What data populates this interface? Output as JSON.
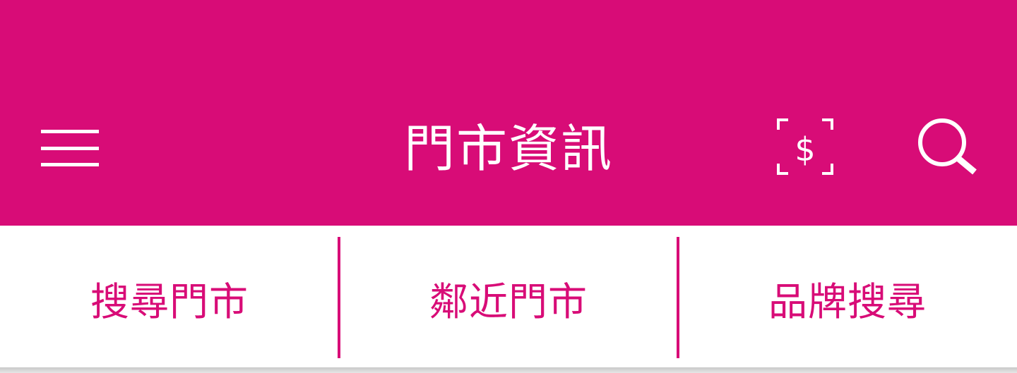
{
  "header": {
    "title": "門市資訊",
    "background_color": "#d80c77",
    "menu_icon": "hamburger-menu-icon",
    "scan_icon": "scan-pay-icon",
    "scan_symbol": "$",
    "search_icon": "search-icon"
  },
  "tabs": [
    {
      "label": "搜尋門市"
    },
    {
      "label": "鄰近門市"
    },
    {
      "label": "品牌搜尋"
    }
  ],
  "colors": {
    "accent": "#d80c77",
    "text_on_accent": "#ffffff"
  }
}
